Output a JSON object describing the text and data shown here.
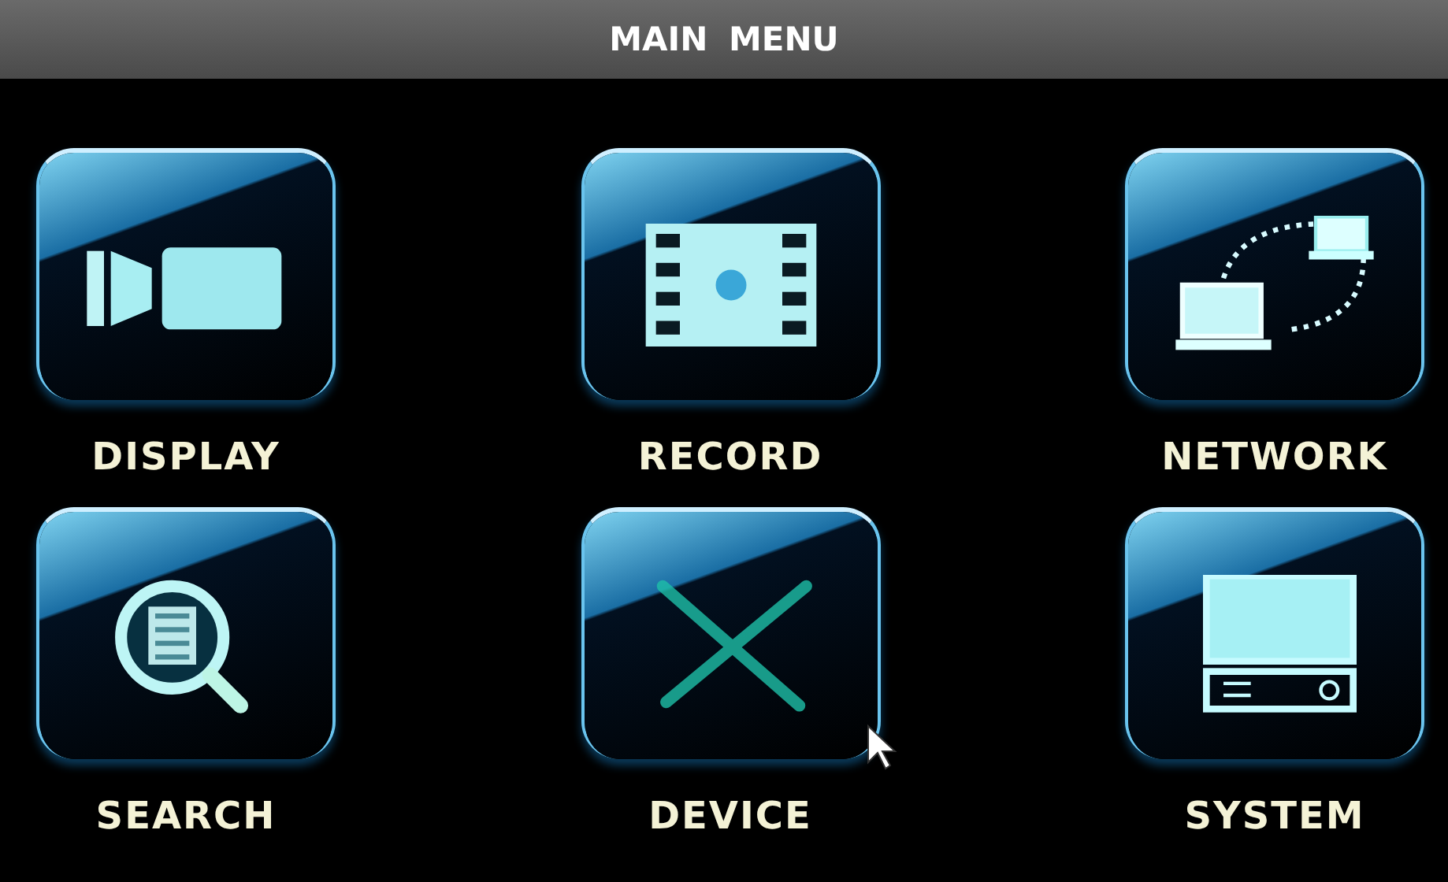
{
  "title": "MAIN MENU",
  "items": [
    {
      "kind": "display",
      "label": "DISPLAY"
    },
    {
      "kind": "record",
      "label": "RECORD"
    },
    {
      "kind": "network",
      "label": "NETWORK"
    },
    {
      "kind": "search",
      "label": "SEARCH"
    },
    {
      "kind": "device",
      "label": "DEVICE"
    },
    {
      "kind": "system",
      "label": "SYSTEM"
    }
  ]
}
